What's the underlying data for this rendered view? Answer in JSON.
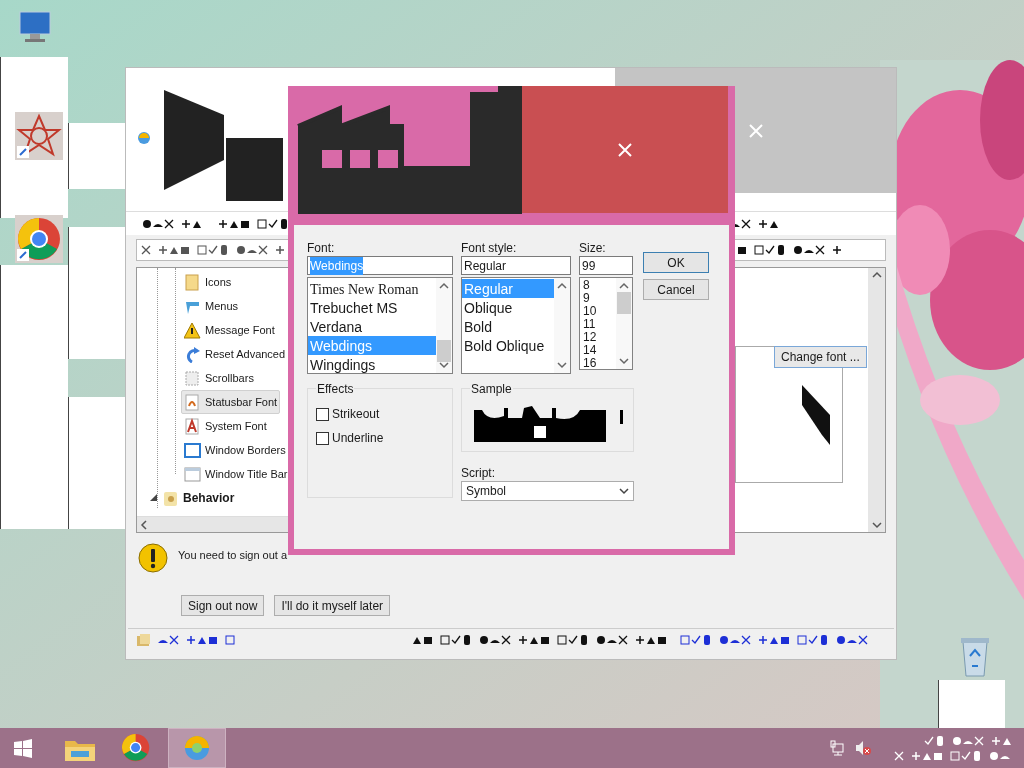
{
  "main_window": {
    "tree": [
      {
        "label": "Icons",
        "selected": false
      },
      {
        "label": "Menus",
        "selected": false
      },
      {
        "label": "Message Font",
        "selected": false
      },
      {
        "label": "Reset Advanced",
        "selected": false
      },
      {
        "label": "Scrollbars",
        "selected": false
      },
      {
        "label": "Statusbar Font",
        "selected": true
      },
      {
        "label": "System Font",
        "selected": false
      },
      {
        "label": "Window Borders",
        "selected": false
      },
      {
        "label": "Window Title Bar",
        "selected": false
      }
    ],
    "sections": [
      {
        "label": "Behavior",
        "expanded": true
      }
    ],
    "change_font_button": "Change font ...",
    "message": "You need to sign out a",
    "buttons": [
      "Sign out now",
      "I'll do it myself later"
    ]
  },
  "font_dialog": {
    "font_label": "Font:",
    "font_value": "Webdings",
    "fonts": [
      {
        "label": "Times New Roman",
        "selected": false
      },
      {
        "label": "Trebuchet MS",
        "selected": false
      },
      {
        "label": "Verdana",
        "selected": false
      },
      {
        "label": "Webdings",
        "selected": true
      },
      {
        "label": "Wingdings",
        "selected": false
      }
    ],
    "style_label": "Font style:",
    "style_value": "Regular",
    "styles": [
      {
        "label": "Regular",
        "selected": true
      },
      {
        "label": "Oblique",
        "selected": false
      },
      {
        "label": "Bold",
        "selected": false
      },
      {
        "label": "Bold Oblique",
        "selected": false
      }
    ],
    "size_label": "Size:",
    "size_value": "99",
    "sizes": [
      "8",
      "9",
      "10",
      "11",
      "12",
      "14",
      "16"
    ],
    "ok": "OK",
    "cancel": "Cancel",
    "effects_label": "Effects",
    "effects": [
      {
        "label": "Strikeout",
        "checked": false
      },
      {
        "label": "Underline",
        "checked": false
      }
    ],
    "sample_label": "Sample",
    "script_label": "Script:",
    "script_value": "Symbol"
  }
}
